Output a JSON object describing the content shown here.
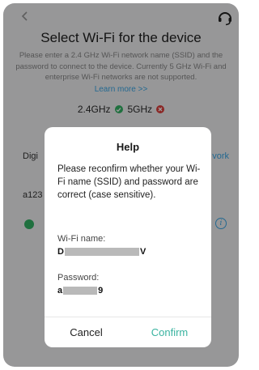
{
  "page": {
    "title": "Select Wi-Fi for the device",
    "description": "Please enter a 2.4 GHz Wi-Fi network name (SSID) and the password to connect to the device. Currently 5 GHz Wi-Fi and enterprise Wi-Fi networks are not supported.",
    "learn_more": "Learn more >>",
    "band_24": "2.4GHz",
    "band_5": "5GHz",
    "ssid_partial": "Digi",
    "network_link_partial": "vork",
    "password_partial": "a123"
  },
  "colors": {
    "accent_blue": "#3aa9e8",
    "ok_green": "#35b566",
    "error_red": "#e0403d",
    "confirm_teal": "#3ab3a0"
  },
  "dialog": {
    "title": "Help",
    "message": "Please reconfirm whether your Wi-Fi name (SSID) and password are correct (case sensitive).",
    "wifi_label": "Wi-Fi name:",
    "wifi_start": "D",
    "wifi_end": "V",
    "password_label": "Password:",
    "password_start": "a",
    "password_end": "9",
    "cancel": "Cancel",
    "confirm": "Confirm"
  }
}
